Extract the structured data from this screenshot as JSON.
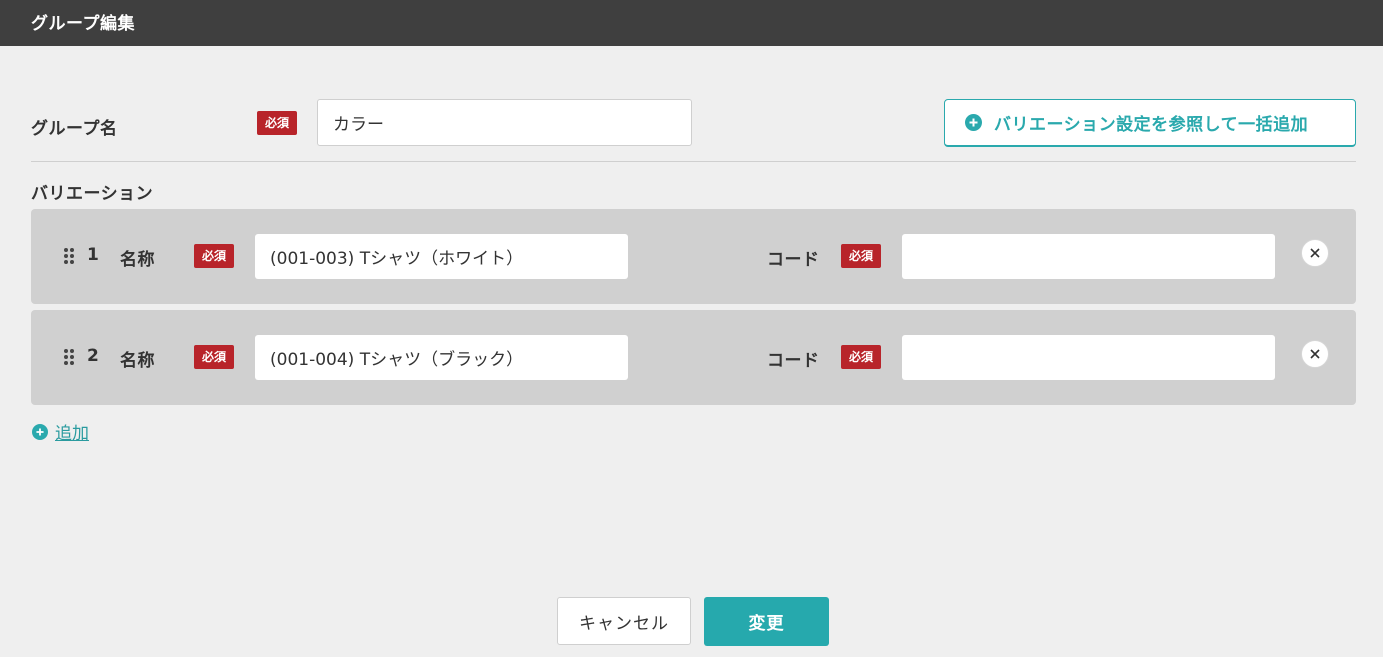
{
  "header": {
    "title": "グループ編集"
  },
  "group": {
    "label": "グループ名",
    "required_badge": "必須",
    "value": "カラー"
  },
  "bulk_add_button": {
    "label": "バリエーション設定を参照して一括追加",
    "icon": "plus-circle-icon"
  },
  "variations": {
    "section_label": "バリエーション",
    "rows": [
      {
        "index": "1",
        "name_label": "名称",
        "required_badge": "必須",
        "name_value": "(001-003) Tシャツ（ホワイト）",
        "code_label": "コード",
        "code_required_badge": "必須",
        "code_value": ""
      },
      {
        "index": "2",
        "name_label": "名称",
        "required_badge": "必須",
        "name_value": "(001-004) Tシャツ（ブラック）",
        "code_label": "コード",
        "code_required_badge": "必須",
        "code_value": ""
      }
    ],
    "add_label": "追加"
  },
  "footer": {
    "cancel_label": "キャンセル",
    "submit_label": "変更"
  },
  "colors": {
    "header_bg": "#3f3f3f",
    "accent": "#26a9ad",
    "required": "#b8242a",
    "row_bg": "#d0d0d0",
    "page_bg": "#efefef"
  }
}
